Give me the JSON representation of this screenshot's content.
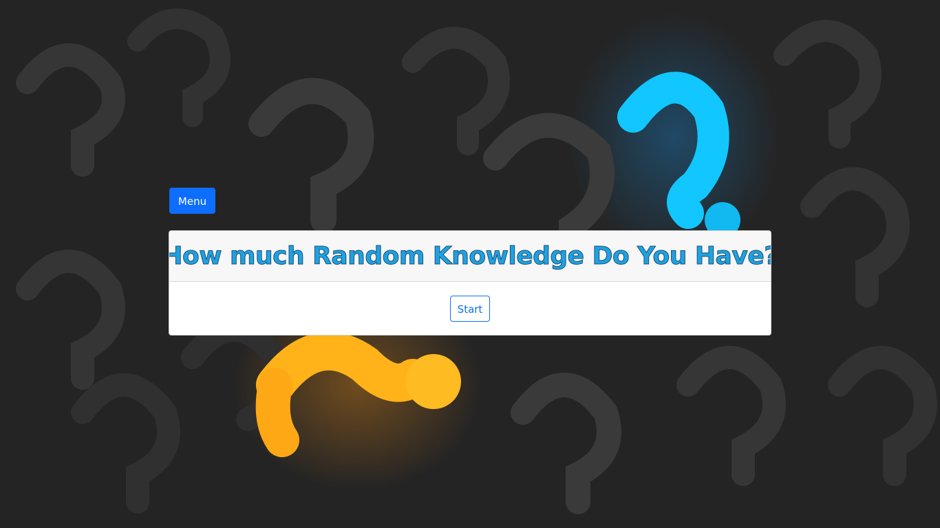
{
  "nav": {
    "menu_label": "Menu"
  },
  "quiz": {
    "title": "How much Random Knowledge Do You Have?",
    "start_label": "Start"
  },
  "colors": {
    "primary": "#0d6efd",
    "title_color": "#1fa2df",
    "background": "#242424",
    "accent_orange": "#ffb319",
    "accent_blue": "#12c6ff"
  },
  "background_image": {
    "icon": "question-marks-pattern"
  }
}
